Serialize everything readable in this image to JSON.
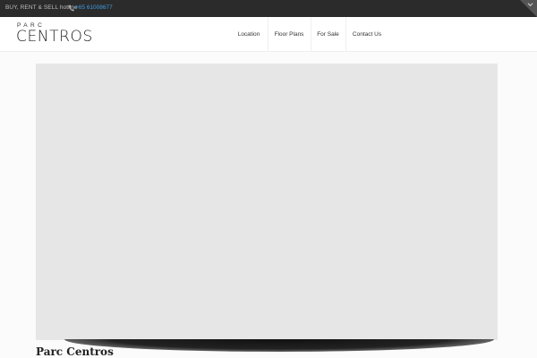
{
  "topbar": {
    "hotline_label": "BUY, RENT & SELL hotline",
    "phone_icon": "phone-icon",
    "phone": "+65 61008677",
    "corner_icon": "chevron-down-icon"
  },
  "header": {
    "logo_small": "PARC",
    "logo_big": "CENTROS",
    "nav": [
      {
        "label": "Location"
      },
      {
        "label": "Floor Plans"
      },
      {
        "label": "For Sale"
      },
      {
        "label": "Contact Us"
      }
    ]
  },
  "main": {
    "title": "Parc Centros"
  },
  "colors": {
    "topbar_bg": "#2b2b2b",
    "link_blue": "#3d9be0",
    "media_placeholder": "#e6e6e6"
  }
}
